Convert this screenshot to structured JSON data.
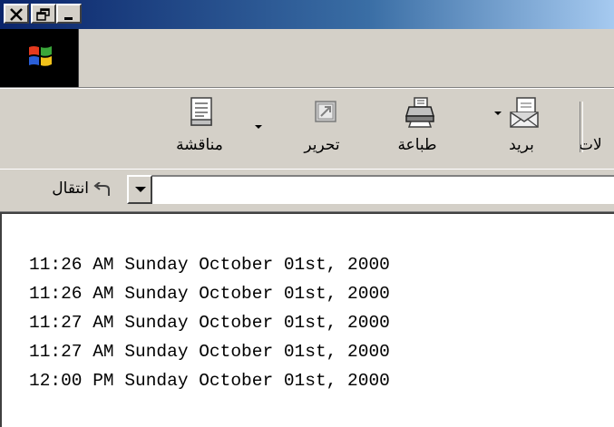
{
  "window": {
    "caption_buttons": [
      {
        "name": "close-icon"
      },
      {
        "name": "restore-icon"
      },
      {
        "name": "minimize-icon"
      }
    ]
  },
  "throbber": {
    "icon": "windows-logo-icon"
  },
  "toolbar": {
    "buttons": [
      {
        "label": "مناقشة",
        "icon": "discuss-icon",
        "has_dropdown": true
      },
      {
        "label": "تحرير",
        "icon": "edit-icon",
        "has_dropdown": false
      },
      {
        "label": "طباعة",
        "icon": "print-icon",
        "has_dropdown": false
      },
      {
        "label": "بريد",
        "icon": "mail-icon",
        "has_dropdown": true
      },
      {
        "label": "لات",
        "icon": "",
        "has_dropdown": false
      }
    ]
  },
  "address": {
    "go_label": "انتقال",
    "go_icon": "go-arrow-icon",
    "value": ""
  },
  "content": {
    "lines": [
      "11:26 AM Sunday October 01st, 2000",
      "11:26 AM Sunday October 01st, 2000",
      "11:27 AM Sunday October 01st, 2000",
      "11:27 AM Sunday October 01st, 2000",
      "12:00 PM Sunday October 01st, 2000"
    ]
  }
}
